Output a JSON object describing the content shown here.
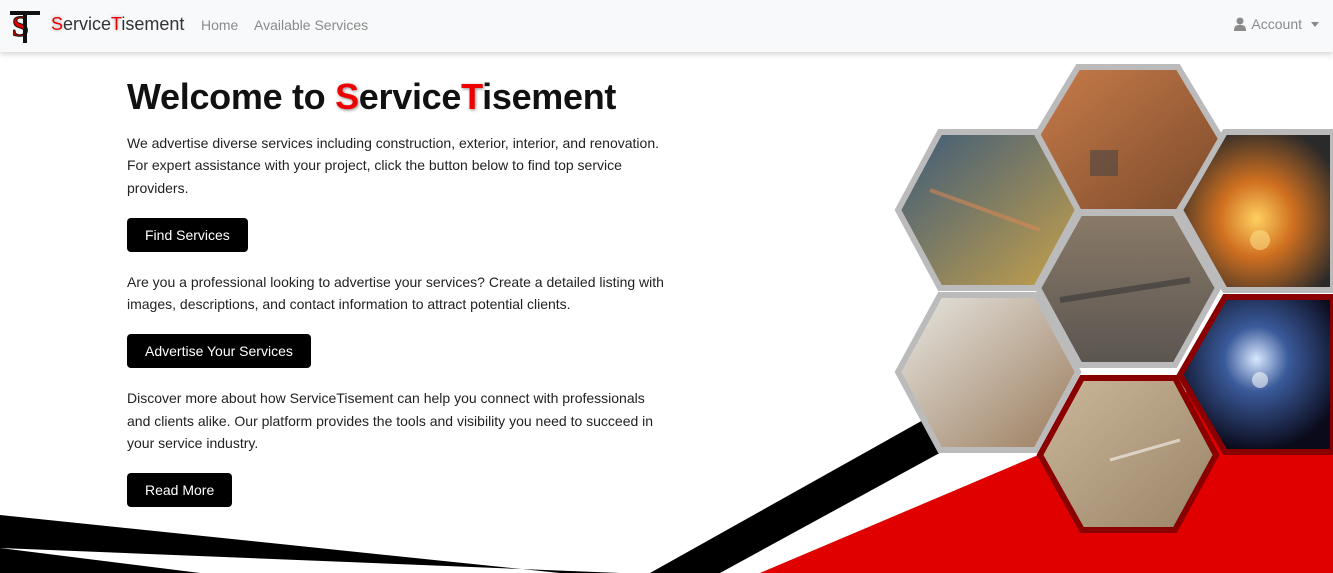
{
  "navbar": {
    "brand": {
      "s": "S",
      "ervice": "ervice",
      "t": "T",
      "isement": "isement"
    },
    "links": [
      "Home",
      "Available Services"
    ],
    "account": "Account"
  },
  "hero": {
    "title_prefix": "Welcome to ",
    "title_s": "S",
    "title_ervice": "ervice",
    "title_t": "T",
    "title_isement": "isement",
    "para1": "We advertise diverse services including construction, exterior, interior, and renovation. For expert assistance with your project, click the button below to find top service providers.",
    "btn1": "Find Services",
    "para2": "Are you a professional looking to advertise your services? Create a detailed listing with images, descriptions, and contact information to attract potential clients.",
    "btn2": "Advertise Your Services",
    "para3": "Discover more about how ServiceTisement can help you connect with professionals and clients alike. Our platform provides the tools and visibility you need to succeed in your service industry.",
    "btn3": "Read More"
  },
  "colors": {
    "accent": "#e00000",
    "dark": "#000000",
    "navbg": "#f8f9fa"
  },
  "gallery": [
    "roofing-photo",
    "electrician-photo",
    "grinding-sparks-photo",
    "concrete-work-photo",
    "drill-ceiling-photo",
    "welding-photo",
    "floor-measuring-photo"
  ]
}
